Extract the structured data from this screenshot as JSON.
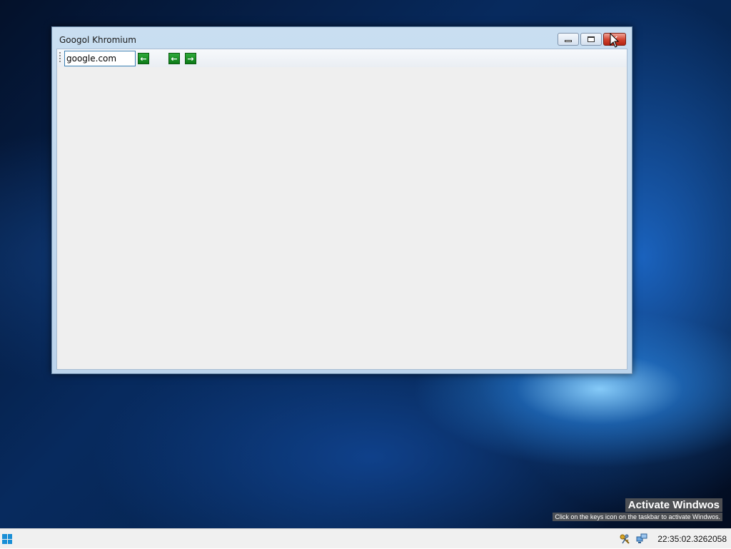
{
  "window": {
    "title": "Googol Khromium",
    "minimize_icon": "minimize-icon",
    "maximize_icon": "maximize-icon",
    "close_icon": "close-icon",
    "close_glyph": "✕"
  },
  "toolbar": {
    "address_value": "google.com",
    "go_icon": "arrow-left-icon",
    "back_icon": "arrow-left-icon",
    "forward_icon": "arrow-right-icon",
    "go_glyph": "←",
    "back_glyph": "←",
    "forward_glyph": "→"
  },
  "watermark": {
    "title": "Activate Windwos",
    "subtitle": "Click on the keys icon on the taskbar to activate Windwos."
  },
  "taskbar": {
    "clock": "22:35:02.3262058",
    "tray_icons": [
      "keys-icon",
      "network-icon"
    ]
  },
  "colors": {
    "accent_green": "#0b7a17",
    "close_red": "#d0402c",
    "start_blue": "#1a8fd6"
  }
}
